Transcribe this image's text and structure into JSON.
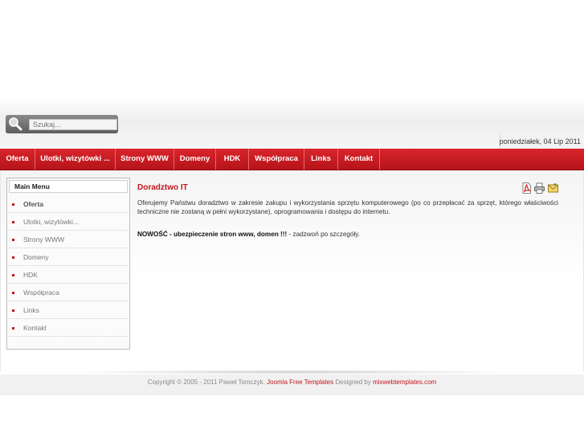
{
  "search": {
    "placeholder": "Szukaj..."
  },
  "date": "poniedziałek, 04 Lip 2011",
  "nav": {
    "items": [
      {
        "label": "Oferta"
      },
      {
        "label": "Ulotki, wizytówki ..."
      },
      {
        "label": "Strony WWW"
      },
      {
        "label": "Domeny"
      },
      {
        "label": "HDK"
      },
      {
        "label": "Współpraca"
      },
      {
        "label": "Links"
      },
      {
        "label": "Kontakt"
      }
    ]
  },
  "main_menu": {
    "title": "Main Menu",
    "items": [
      {
        "label": "Oferta",
        "active": true
      },
      {
        "label": "Ulotki, wizytówki..."
      },
      {
        "label": "Strony WWW"
      },
      {
        "label": "Domeny"
      },
      {
        "label": "HDK"
      },
      {
        "label": "Współpraca"
      },
      {
        "label": "Links"
      },
      {
        "label": "Kontakt"
      }
    ]
  },
  "article": {
    "title": "Doradztwo IT",
    "icons": [
      "pdf-icon",
      "print-icon",
      "email-icon"
    ],
    "body": "Oferujemy Państwu doradztwo w zakresie zakupu i wykorzystania sprzętu komputerowego (po co przepłacać za sprzęt, którego właściwości techniczne nie zostaną w pełni wykorzystane), oprogramowania i dostępu do internetu.",
    "news_bold": "NOWOŚĆ - ubezpieczenie stron www, domen !!!",
    "news_rest": " - zadzwoń po szczegóły."
  },
  "footer": {
    "copyright": "Copyright © 2005 - 2011 Paweł Tomczyk.",
    "link1": "Joomla Free Templates",
    "designed_by": "Designed by",
    "link2": "mixwebtemplates.com"
  },
  "colors": {
    "accent": "#c1161c",
    "nav_bg": "#c8191f"
  }
}
